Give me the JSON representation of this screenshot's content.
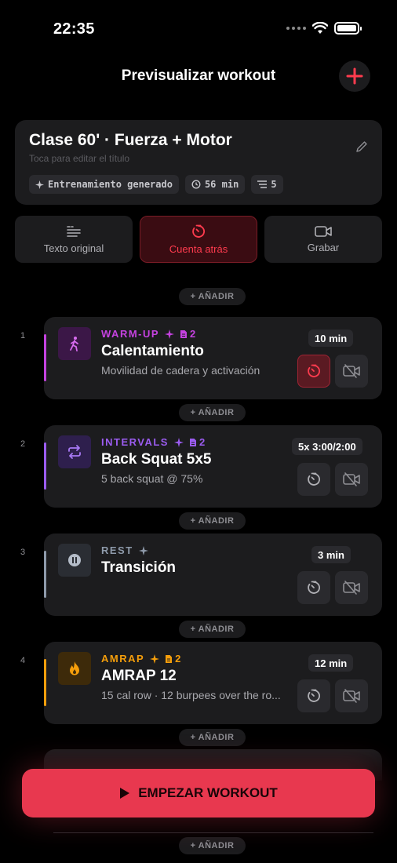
{
  "status_bar": {
    "time": "22:35"
  },
  "header": {
    "title": "Previsualizar workout"
  },
  "workout": {
    "title": "Clase 60' · Fuerza + Motor",
    "subtitle": "Toca para editar el título",
    "chips": {
      "generated": "Entrenamiento generado",
      "duration": "56 min",
      "blocks": "5"
    }
  },
  "modes": [
    {
      "label": "Texto original",
      "icon": "quote-list-icon",
      "active": false
    },
    {
      "label": "Cuenta atrás",
      "icon": "countdown-timer-icon",
      "active": true
    },
    {
      "label": "Grabar",
      "icon": "video-camera-icon",
      "active": false
    }
  ],
  "add_label": "+ AÑADIR",
  "blocks": [
    {
      "number": "1",
      "tag": "WARM-UP",
      "sources": "2",
      "title": "Calentamiento",
      "description": "Movilidad de cadera y activación",
      "duration": "10 min",
      "color": "#c542e0",
      "icon": "walking-figure-icon",
      "timer_active": true
    },
    {
      "number": "2",
      "tag": "INTERVALS",
      "sources": "2",
      "title": "Back Squat 5x5",
      "description": "5 back squat @ 75%",
      "duration": "5x 3:00/2:00",
      "color": "#9b5cf0",
      "icon": "repeat-icon",
      "timer_active": false
    },
    {
      "number": "3",
      "tag": "REST",
      "sources": "",
      "title": "Transición",
      "description": "",
      "duration": "3 min",
      "color": "#8e9aaa",
      "icon": "pause-icon",
      "timer_active": false
    },
    {
      "number": "4",
      "tag": "AMRAP",
      "sources": "2",
      "title": "AMRAP 12",
      "description": "15 cal row · 12 burpees over the ro...",
      "duration": "12 min",
      "color": "#f59e0b",
      "icon": "flame-icon",
      "timer_active": false
    }
  ],
  "start_button": {
    "label": "EMPEZAR WORKOUT"
  },
  "colors": {
    "accent": "#e8384f",
    "card": "#1c1c1e",
    "background": "#000000"
  }
}
